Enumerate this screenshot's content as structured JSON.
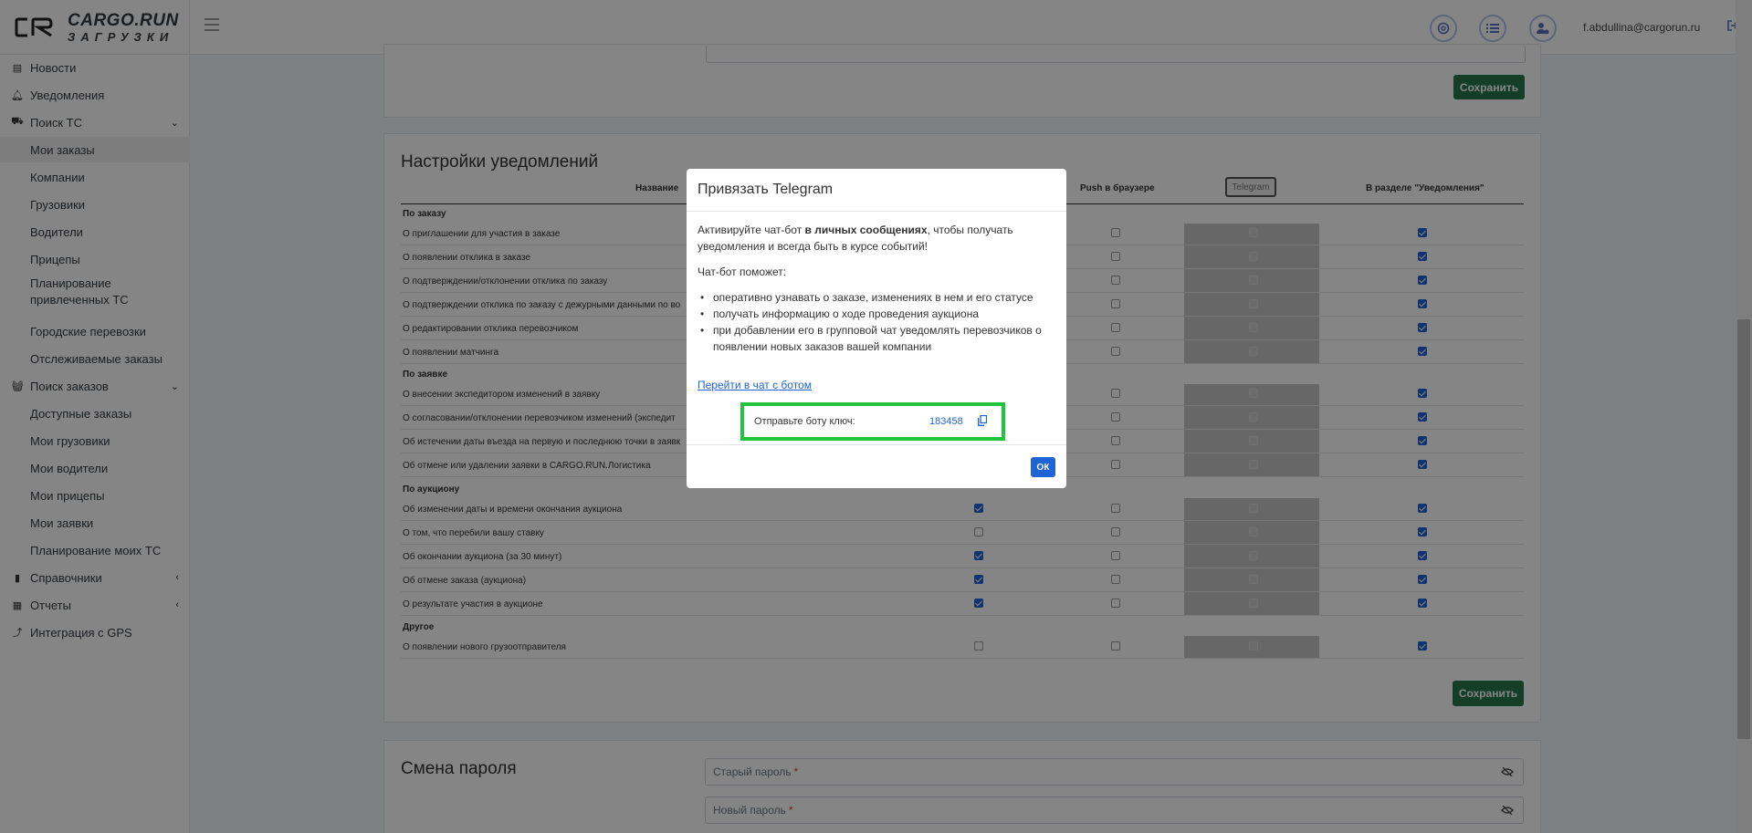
{
  "app": {
    "brand_line1": "CARGO.RUN",
    "brand_line2": "ЗАГРУЗКИ",
    "user_email": "f.abdullina@cargorun.ru"
  },
  "header_icons": [
    "support-icon",
    "list-icon",
    "user-settings-icon"
  ],
  "sidebar": {
    "items": [
      {
        "label": "Новости",
        "icon": "newspaper-icon"
      },
      {
        "label": "Уведомления",
        "icon": "bell-icon"
      },
      {
        "label": "Поиск ТС",
        "icon": "truck-icon"
      },
      {
        "label": "Мои заказы"
      },
      {
        "label": "Компании"
      },
      {
        "label": "Грузовики"
      },
      {
        "label": "Водители"
      },
      {
        "label": "Прицепы"
      },
      {
        "label": "Планирование привлеченных ТС"
      },
      {
        "label": "Городские перевозки"
      },
      {
        "label": "Отслеживаемые заказы"
      },
      {
        "label": "Поиск заказов",
        "icon": "basket-icon"
      },
      {
        "label": "Доступные заказы"
      },
      {
        "label": "Мои грузовики"
      },
      {
        "label": "Мои водители"
      },
      {
        "label": "Мои прицепы"
      },
      {
        "label": "Мои заявки"
      },
      {
        "label": "Планирование моих ТС"
      },
      {
        "label": "Справочники",
        "icon": "book-icon"
      },
      {
        "label": "Отчеты",
        "icon": "report-icon"
      },
      {
        "label": "Интеграция с GPS",
        "icon": "route-icon"
      }
    ]
  },
  "top_card": {
    "save_label": "Сохранить"
  },
  "notifications": {
    "title": "Настройки уведомлений",
    "columns": {
      "name": "Название",
      "push": "Push в браузере",
      "telegram": "Telegram",
      "section": "В разделе \"Уведомления\""
    },
    "groups": [
      {
        "title": "По заказу"
      },
      {
        "title": "По заявке"
      },
      {
        "title": "По аукциону"
      },
      {
        "title": "Другое"
      }
    ],
    "rows": [
      {
        "label": "О приглашении для участия в заказе",
        "email": null,
        "push": false,
        "section": true
      },
      {
        "label": "О появлении отклика в заказе",
        "email": null,
        "push": false,
        "section": true
      },
      {
        "label": "О подтверждении/отклонении отклика по заказу",
        "email": null,
        "push": false,
        "section": true
      },
      {
        "label": "О подтверждении отклика по заказу с дежурными данными по во",
        "email": null,
        "push": false,
        "section": true
      },
      {
        "label": "О редактировании отклика перевозчиком",
        "email": null,
        "push": false,
        "section": true
      },
      {
        "label": "О появлении матчинга",
        "email": null,
        "push": false,
        "section": true
      },
      {
        "label": "О внесении экспедитором изменений в заявку",
        "email": null,
        "push": false,
        "section": true
      },
      {
        "label": "О согласовании/отклонении перевозчиком изменений (экспедит",
        "email": null,
        "push": false,
        "section": true
      },
      {
        "label": "Об истечении даты въезда на первую и последнюю точки в заявк",
        "email": null,
        "push": false,
        "section": true
      },
      {
        "label": "Об отмене или удалении заявки в CARGO.RUN.Логистика",
        "email": null,
        "push": false,
        "section": true
      },
      {
        "label": "Об изменении даты и времени окончания аукциона",
        "email": true,
        "push": false,
        "section": true
      },
      {
        "label": "О том, что перебили вашу ставку",
        "email": false,
        "push": false,
        "section": true
      },
      {
        "label": "Об окончании аукциона (за 30 минут)",
        "email": true,
        "push": false,
        "section": true
      },
      {
        "label": "Об отмене заказа (аукциона)",
        "email": true,
        "push": false,
        "section": true
      },
      {
        "label": "О результате участия в аукционе",
        "email": true,
        "push": false,
        "section": true
      },
      {
        "label": "О появлении нового грузоотправителя",
        "email": false,
        "push": false,
        "section": true
      }
    ],
    "save_label": "Сохранить"
  },
  "password": {
    "title": "Смена пароля",
    "old_placeholder": "Старый пароль",
    "new_placeholder": "Новый пароль",
    "required_mark": "*"
  },
  "modal": {
    "title": "Привязать Telegram",
    "intro_before": "Активируйте чат-бот ",
    "intro_bold": "в личных сообщениях",
    "intro_after": ", чтобы получать уведомления и всегда быть в курсе событий!",
    "helps": "Чат-бот поможет:",
    "bullets": [
      "оперативно узнавать о заказе, изменениях в нем и его статусе",
      "получать информацию о ходе проведения аукциона",
      "при добавлении его в групповой чат уведомлять перевозчиков о появлении новых заказов вашей компании"
    ],
    "bot_link": "Перейти в чат с ботом",
    "key_label": "Отправьте боту ключ:",
    "key_value": "183458",
    "ok_label": "ОК"
  }
}
